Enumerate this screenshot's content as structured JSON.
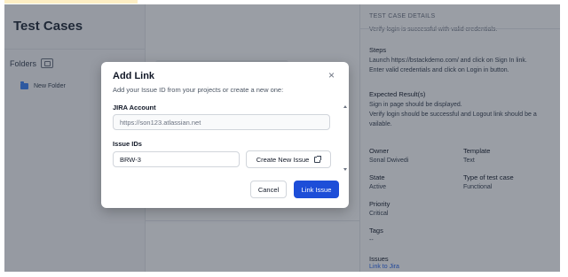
{
  "left_panel": {
    "title": "Test Cases",
    "folders_label": "Folders",
    "folder_item": "New Folder"
  },
  "details": {
    "header": "TEST CASE DETAILS",
    "truncated_line": "Verify login is successful with valid credentials.",
    "steps_label": "Steps",
    "steps_line1": "Launch https://bstackdemo.com/ and click on Sign In link.",
    "steps_line2": "Enter valid credentials and click on Login in button.",
    "expected_label": "Expected Result(s)",
    "expected_line1": "Sign in page should be displayed.",
    "expected_line2": "Verify login should be successful and Logout link should be a",
    "expected_line3": "vailable.",
    "owner_label": "Owner",
    "owner_value": "Sonal Dwivedi",
    "template_label": "Template",
    "template_value": "Text",
    "state_label": "State",
    "state_value": "Active",
    "type_label": "Type of test case",
    "type_value": "Functional",
    "priority_label": "Priority",
    "priority_value": "Critical",
    "tags_label": "Tags",
    "tags_value": "--",
    "issues_label": "Issues",
    "issues_link": "Link to Jira"
  },
  "modal": {
    "title": "Add Link",
    "close_glyph": "×",
    "subtitle": "Add your Issue ID from your projects or create a new one:",
    "jira_label": "JIRA Account",
    "jira_value": "https://son123.atlassian.net",
    "issue_label": "Issue IDs",
    "issue_value": "BRW-3",
    "create_label": "Create New Issue",
    "cancel_label": "Cancel",
    "link_label": "Link Issue"
  },
  "colors": {
    "primary": "#1d4ed8",
    "overlay": "rgba(31,41,55,0.45)",
    "folder": "#3b82f6"
  }
}
